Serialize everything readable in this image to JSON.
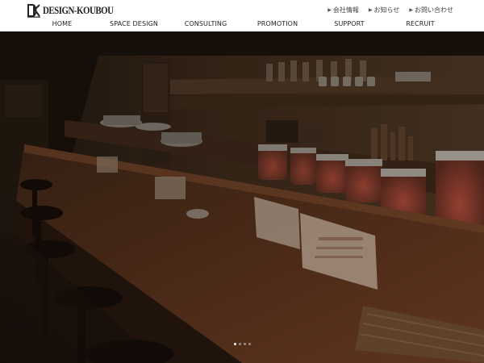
{
  "header": {
    "logo": {
      "mark": "DK",
      "text": "DESIGN-KOUBOU"
    },
    "util_links": [
      {
        "label": "会社情報",
        "icon": "triangle-right-icon"
      },
      {
        "label": "お知らせ",
        "icon": "triangle-right-icon"
      },
      {
        "label": "お問い合わせ",
        "icon": "triangle-right-icon"
      }
    ],
    "nav": [
      {
        "label": "HOME"
      },
      {
        "label": "SPACE DESIGN"
      },
      {
        "label": "CONSULTING"
      },
      {
        "label": "PROMOTION"
      },
      {
        "label": "SUPPORT"
      },
      {
        "label": "RECRUIT"
      }
    ]
  },
  "hero": {
    "image": "restaurant-bar-counter-photo",
    "slides_total": 4,
    "active_slide": 1
  },
  "colors": {
    "header_bg": "#ffffff",
    "nav_text": "#222222",
    "hero_dark": "#2f2218",
    "wood_warm": "#6b3d24",
    "dot_active": "#ffffff"
  }
}
